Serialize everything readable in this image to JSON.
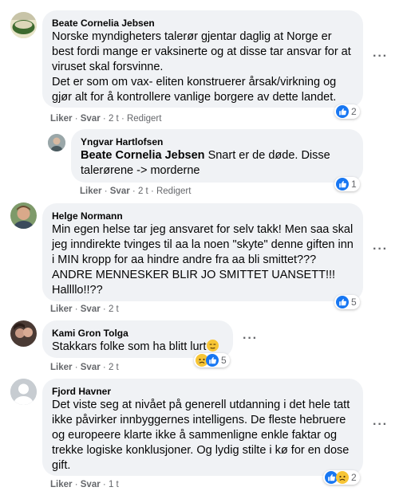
{
  "comments": [
    {
      "author": "Beate Cornelia Jebsen",
      "text": "Norske myndigheters talerør gjentar daglig at Norge er best fordi mange er vaksinerte og at disse tar ansvar for at viruset skal forsvinne.\nDet er som om vax- eliten konstruerer årsak/virkning og gjør alt for å kontrollere vanlige borgere av dette landet.",
      "like": "Liker",
      "reply": "Svar",
      "time": "2 t",
      "edited": "Redigert",
      "reaction_count": "2",
      "reactions": [
        "like-icon"
      ]
    },
    {
      "author": "Yngvar Hartlofsen",
      "mention": "Beate Cornelia Jebsen",
      "text": " Snart er de døde. Disse talerørene -> morderne",
      "like": "Liker",
      "reply": "Svar",
      "time": "2 t",
      "edited": "Redigert",
      "reaction_count": "1",
      "reactions": [
        "like-icon"
      ]
    },
    {
      "author": "Helge Normann",
      "text": "Min egen helse tar jeg ansvaret for selv takk! Men saa skal jeg inndirekte tvinges til aa la noen \"skyte\" denne giften inn i MIN kropp for aa hindre andre fra aa bli smittet??? ANDRE MENNESKER BLIR JO SMITTET UANSETT!!! Hallllo!!??",
      "like": "Liker",
      "reply": "Svar",
      "time": "2 t",
      "reaction_count": "5",
      "reactions": [
        "like-icon"
      ]
    },
    {
      "author": "Kami Gron Tolga",
      "text": "Stakkars folke som ha blitt lurt",
      "like": "Liker",
      "reply": "Svar",
      "time": "2 t",
      "reaction_count": "5",
      "reactions": [
        "sad-icon",
        "like-icon"
      ]
    },
    {
      "author": "Fjord Havner",
      "text": "Det viste seg at nivået på generell utdanning i det hele tatt ikke påvirker innbyggernes intelligens. De fleste hebruere og europeere klarte ikke å sammenligne enkle faktar og trekke logiske konklusjoner. Og lydig stilte i kø for en dose gift.",
      "like": "Liker",
      "reply": "Svar",
      "time": "1 t",
      "reaction_count": "2",
      "reactions": [
        "like-icon",
        "sad-icon"
      ]
    }
  ],
  "separator": "·",
  "more_icon": "more-options-icon",
  "colors": {
    "bubble": "#f0f2f5",
    "like": "#1877f2",
    "meta": "#65676b",
    "sad": "#f7c535"
  }
}
